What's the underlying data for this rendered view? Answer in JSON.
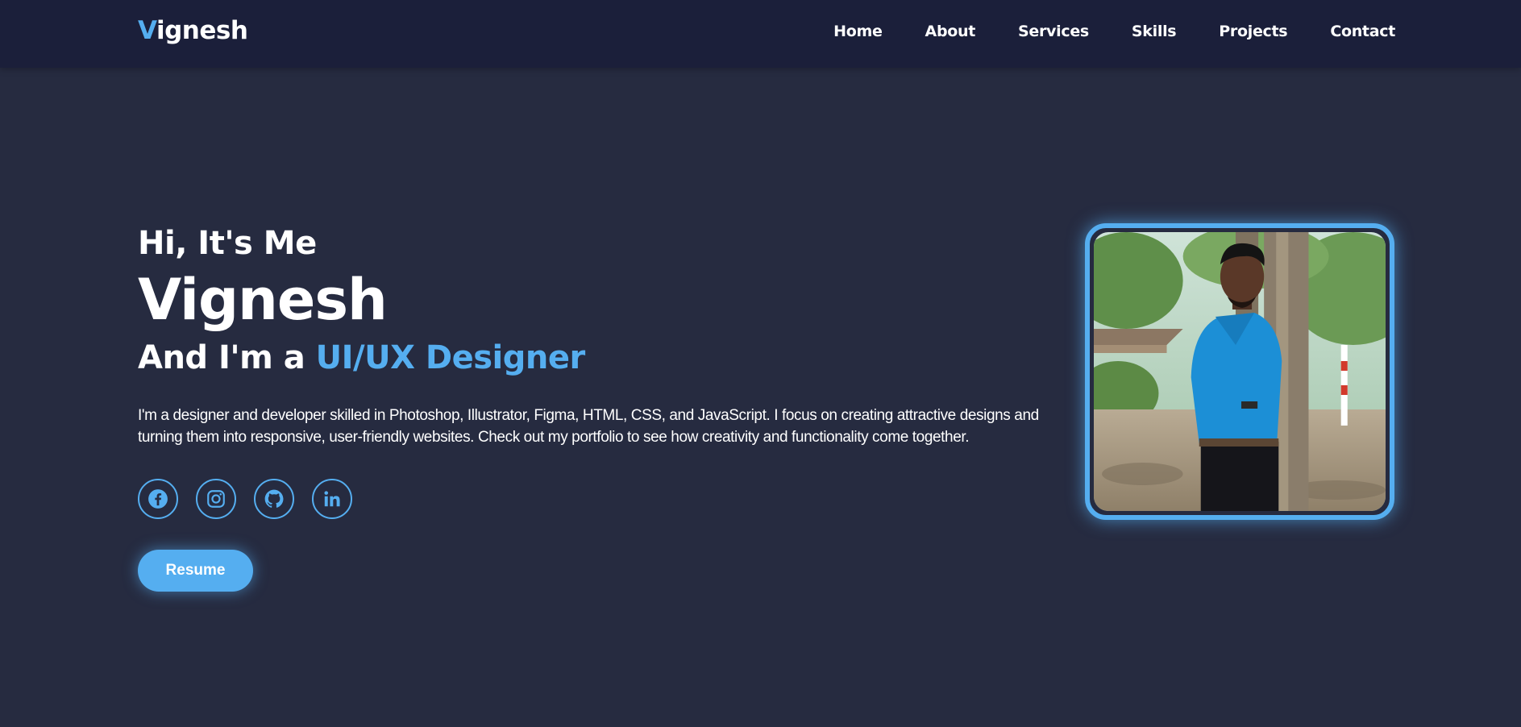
{
  "logo": {
    "initial": "V",
    "rest": "ignesh"
  },
  "nav": {
    "items": [
      {
        "label": "Home"
      },
      {
        "label": "About"
      },
      {
        "label": "Services"
      },
      {
        "label": "Skills"
      },
      {
        "label": "Projects"
      },
      {
        "label": "Contact"
      }
    ]
  },
  "hero": {
    "greeting": "Hi, It's Me",
    "name": "Vignesh",
    "role_prefix": "And I'm a ",
    "role_highlight": "UI/UX Designer",
    "bio": "I'm a designer and developer skilled in Photoshop, Illustrator, Figma, HTML, CSS, and JavaScript. I focus on creating attractive designs and turning them into responsive, user-friendly websites. Check out my portfolio to see how creativity and functionality come together.",
    "resume_label": "Resume"
  },
  "socials": [
    {
      "icon": "facebook-icon"
    },
    {
      "icon": "instagram-icon"
    },
    {
      "icon": "github-icon"
    },
    {
      "icon": "linkedin-icon"
    }
  ],
  "colors": {
    "accent": "#55aef0",
    "background": "#262b40",
    "navbar": "#1b1f3a"
  }
}
